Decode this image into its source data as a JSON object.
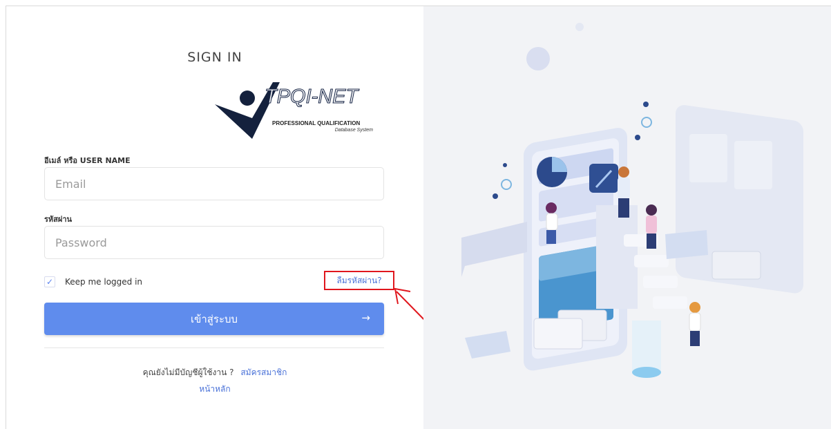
{
  "form": {
    "title": "SIGN IN",
    "email_label": "อีเมล์ หรือ USER NAME",
    "email_placeholder": "Email",
    "password_label": "รหัสผ่าน",
    "password_placeholder": "Password",
    "remember_label": "Keep me logged in",
    "remember_checked": true,
    "forgot_link": "ลืมรหัสผ่าน?",
    "submit_label": "เข้าสู่ระบบ",
    "no_account_text": "คุณยังไม่มีบัญชีผู้ใช้งาน ?",
    "register_link": "สมัครสมาชิก",
    "home_link": "หน้าหลัก"
  },
  "logo": {
    "brand": "TPQI-NET",
    "line1": "PROFESSIONAL QUALIFICATION",
    "line2": "Database System"
  },
  "icons": {
    "checkbox": "check-icon",
    "submit_arrow": "arrow-right-icon",
    "annotation": "red-arrow-annotation"
  },
  "colors": {
    "primary": "#5f8ced",
    "link": "#4a72d8",
    "highlight": "#e0161d",
    "panel_bg": "#f2f3f6"
  }
}
